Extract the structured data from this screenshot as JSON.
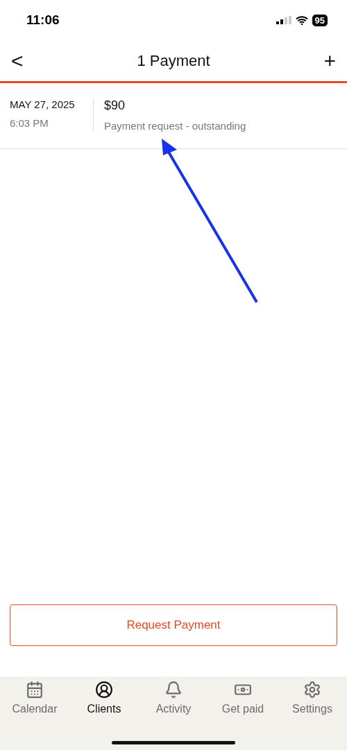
{
  "status_bar": {
    "time": "11:06",
    "battery": "95"
  },
  "header": {
    "back": "<",
    "title": "1 Payment",
    "add": "+"
  },
  "payments": [
    {
      "date": "MAY 27, 2025",
      "time": "6:03 PM",
      "amount": "$90",
      "status": "Payment request - outstanding"
    }
  ],
  "request_button": "Request Payment",
  "tab_bar": [
    {
      "kind": "calendar",
      "label": "Calendar",
      "selected": false
    },
    {
      "kind": "clients",
      "label": "Clients",
      "selected": true
    },
    {
      "kind": "activity",
      "label": "Activity",
      "selected": false
    },
    {
      "kind": "getpaid",
      "label": "Get paid",
      "selected": false
    },
    {
      "kind": "settings",
      "label": "Settings",
      "selected": false
    }
  ]
}
